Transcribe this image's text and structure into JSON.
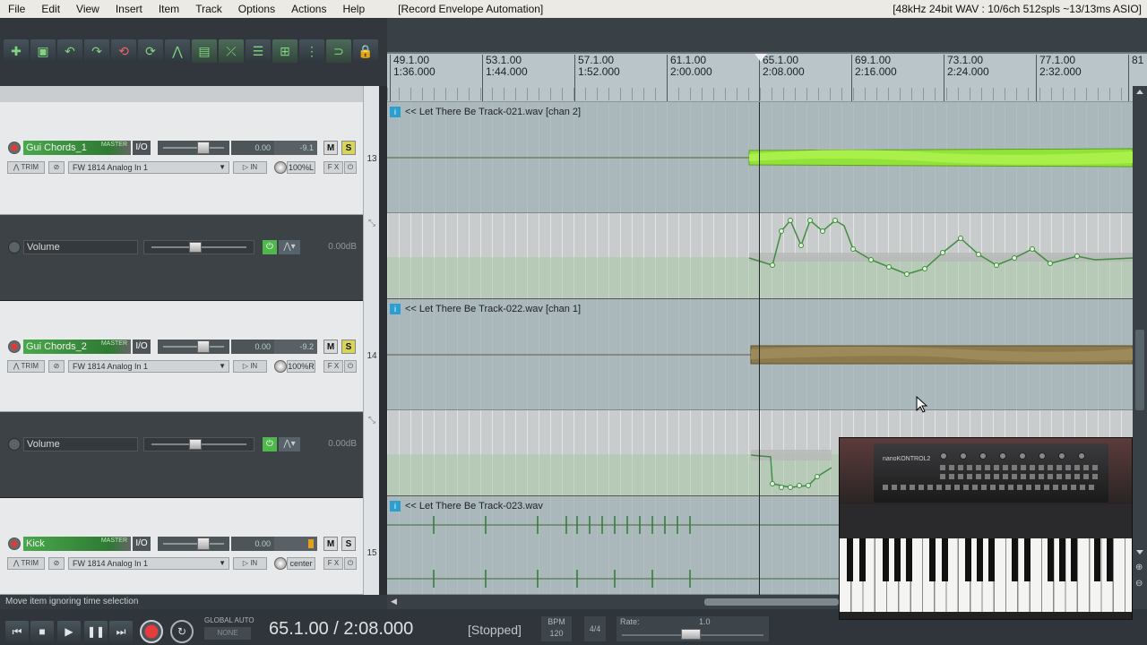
{
  "menu": {
    "items": [
      "File",
      "Edit",
      "View",
      "Insert",
      "Item",
      "Track",
      "Options",
      "Actions",
      "Help"
    ],
    "window_title": "[Record Envelope Automation]",
    "audio_status": "[48kHz 24bit WAV : 10/6ch 512spls ~13/13ms ASIO]"
  },
  "toolbar": {
    "buttons": [
      "new-project-icon",
      "save-icon",
      "undo-icon",
      "redo-icon",
      "metronome-icon",
      "ripple-icon",
      "snap-icon",
      "grid-icon",
      "auto-crossfade-icon",
      "envelope-link-icon",
      "item-grouping-icon",
      "grid-lines-icon",
      "loop-points-icon",
      "lock-icon"
    ]
  },
  "ruler": {
    "marks": [
      {
        "bar": "49.1.00",
        "time": "1:36.000"
      },
      {
        "bar": "53.1.00",
        "time": "1:44.000"
      },
      {
        "bar": "57.1.00",
        "time": "1:52.000"
      },
      {
        "bar": "61.1.00",
        "time": "2:00.000"
      },
      {
        "bar": "65.1.00",
        "time": "2:08.000"
      },
      {
        "bar": "69.1.00",
        "time": "2:16.000"
      },
      {
        "bar": "73.1.00",
        "time": "2:24.000"
      },
      {
        "bar": "77.1.00",
        "time": "2:32.000"
      },
      {
        "bar": "81",
        "time": ""
      }
    ]
  },
  "tracks": [
    {
      "number": "13",
      "name": "Gui Chords_1",
      "io": "I/O",
      "fader_db": "0.00",
      "vu_peak": "-9.1",
      "mute": "M",
      "solo": "S",
      "trim": "TRIM",
      "input": "FW 1814 Analog In 1",
      "in_label": "IN",
      "pan": "100%L",
      "fx": "F X",
      "master_send": "MASTER",
      "item": "<< Let There Be Track-021.wav [chan 2]",
      "envelope": {
        "name": "Volume",
        "value": "0.00dB"
      }
    },
    {
      "number": "14",
      "name": "Gui Chords_2",
      "io": "I/O",
      "fader_db": "0.00",
      "vu_peak": "-9.2",
      "mute": "M",
      "solo": "S",
      "trim": "TRIM",
      "input": "FW 1814 Analog In 1",
      "in_label": "IN",
      "pan": "100%R",
      "fx": "F X",
      "master_send": "MASTER",
      "item": "<< Let There Be Track-022.wav [chan 1]",
      "envelope": {
        "name": "Volume",
        "value": "0.00dB"
      }
    },
    {
      "number": "15",
      "name": "Kick",
      "io": "I/O",
      "fader_db": "0.00",
      "vu_peak": "",
      "mute": "M",
      "solo": "S",
      "trim": "TRIM",
      "input": "FW 1814 Analog In 1",
      "in_label": "IN",
      "pan": "center",
      "fx": "F X",
      "master_send": "MASTER",
      "item": "<< Let There Be Track-023.wav"
    }
  ],
  "status_line": "Move item ignoring time selection",
  "transport": {
    "global_auto": "GLOBAL AUTO",
    "global_mode": "NONE",
    "position": "65.1.00 / 2:08.000",
    "state": "[Stopped]",
    "bpm_label": "BPM",
    "bpm": "120",
    "time_sig": "4/4",
    "rate_label": "Rate:",
    "rate": "1.0"
  },
  "overlay": {
    "device_label": "nanoKONTROL2"
  },
  "colors": {
    "track_green": "#49a84b",
    "audio_green": "#8fdc3a",
    "audio_brown": "#8c7a4c",
    "envelope_green": "#3f8f3f",
    "solo_yellow": "#d8d45a",
    "record_red": "#e63c3c"
  }
}
